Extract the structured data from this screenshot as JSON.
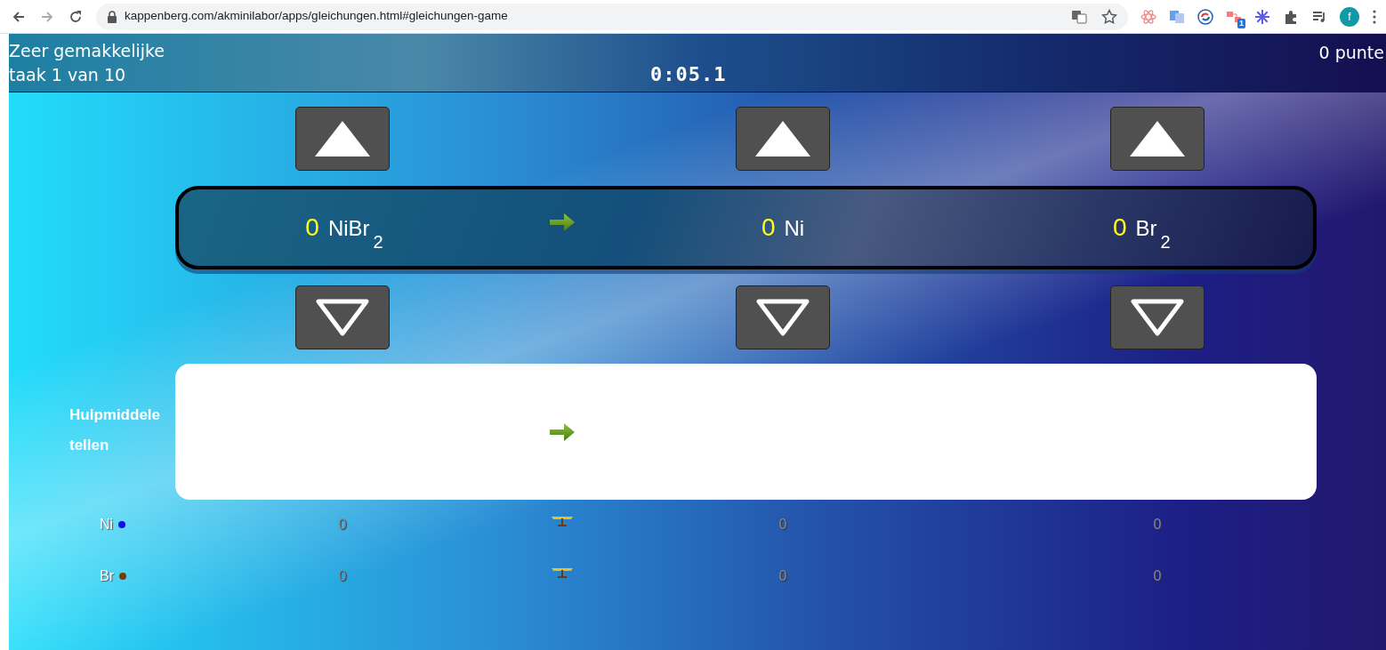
{
  "browser": {
    "url": "kappenberg.com/akminilabor/apps/gleichungen.html#gleichungen-game",
    "extension_badge": "1",
    "avatar_letter": "f"
  },
  "header": {
    "level": "Zeer gemakkelijke",
    "task": "taak 1 van 10",
    "timer": "0:05.1",
    "score": "0 punte"
  },
  "equation": {
    "terms": [
      {
        "kind": "term",
        "coefficient": "0",
        "formula": "NiBr$_{2}$"
      },
      {
        "kind": "arrow"
      },
      {
        "kind": "term",
        "coefficient": "0",
        "formula": "Ni"
      },
      {
        "kind": "term",
        "coefficient": "0",
        "formula": "Br$_{2}$"
      }
    ]
  },
  "help_label_lines": [
    "Hulpmiddele",
    "tellen"
  ],
  "counts": [
    {
      "element": "Ni",
      "color": "#0a14e6",
      "values": [
        "0",
        "0",
        "0"
      ]
    },
    {
      "element": "Br",
      "color": "#7a3a05",
      "values": [
        "0",
        "0",
        "0"
      ]
    }
  ]
}
